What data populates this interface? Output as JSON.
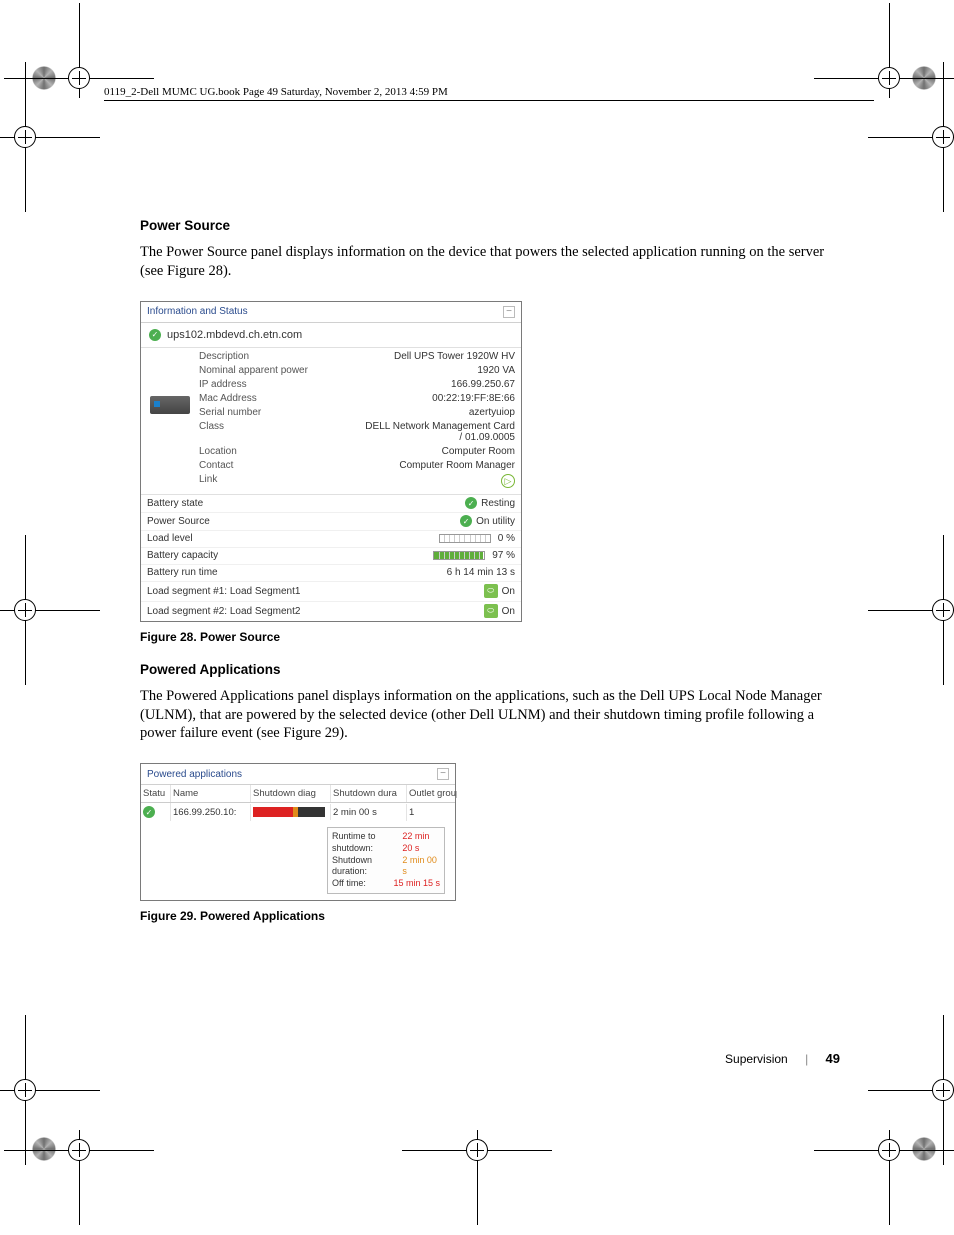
{
  "crop_header": "0119_2-Dell MUMC UG.book  Page 49  Saturday, November 2, 2013  4:59 PM",
  "sec1": {
    "heading": "Power Source",
    "body": "The Power Source panel displays information on the device that powers the selected application running on the server (see Figure 28).",
    "caption": "Figure 28.  Power Source"
  },
  "panel1": {
    "title": "Information and Status",
    "device_name": "ups102.mbdevd.ch.etn.com",
    "rows": [
      {
        "label": "Description",
        "value": "Dell UPS Tower 1920W HV"
      },
      {
        "label": "Nominal apparent power",
        "value": "1920 VA"
      },
      {
        "label": "IP address",
        "value": "166.99.250.67"
      },
      {
        "label": "Mac Address",
        "value": "00:22:19:FF:8E:66"
      },
      {
        "label": "Serial number",
        "value": "azertyuiop"
      },
      {
        "label": "Class",
        "value": "DELL Network Management Card / 01.09.0005"
      },
      {
        "label": "Location",
        "value": "Computer Room"
      },
      {
        "label": "Contact",
        "value": "Computer Room Manager"
      },
      {
        "label": "Link",
        "value": ""
      }
    ],
    "kv": [
      {
        "label": "Battery state",
        "value": "Resting",
        "icon": "ok"
      },
      {
        "label": "Power Source",
        "value": "On utility",
        "icon": "ok"
      },
      {
        "label": "Load level",
        "value": "0 %",
        "bar_pct": 0,
        "bar_color": "#fff"
      },
      {
        "label": "Battery capacity",
        "value": "97 %",
        "bar_pct": 97,
        "bar_color": "#5fae3a"
      },
      {
        "label": "Battery run time",
        "value": "6 h 14 min 13 s"
      },
      {
        "label": "Load segment #1: Load Segment1",
        "value": "On",
        "icon": "outlet"
      },
      {
        "label": "Load segment #2: Load Segment2",
        "value": "On",
        "icon": "outlet"
      }
    ]
  },
  "sec2": {
    "heading": "Powered Applications",
    "body": "The Powered Applications panel displays information on the applications, such as the Dell UPS Local Node Manager (ULNM), that are powered by the selected device (other Dell ULNM) and their shutdown timing profile following a power failure event (see Figure 29).",
    "caption": "Figure 29.  Powered Applications"
  },
  "panel2": {
    "title": "Powered applications",
    "headers": [
      "Statu",
      "Name",
      "Shutdown diag",
      "Shutdown dura",
      "Outlet group"
    ],
    "row": {
      "name": "166.99.250.10:",
      "duration": "2 min 00 s",
      "outlet": "1"
    },
    "tooltip": {
      "l1_label": "Runtime to shutdown:",
      "l1_val": "22 min 20 s",
      "l2_label": "Shutdown duration:",
      "l2_val": "2 min 00 s",
      "l3_label": "Off time:",
      "l3_val": "15 min 15 s"
    }
  },
  "footer": {
    "section": "Supervision",
    "page": "49"
  }
}
